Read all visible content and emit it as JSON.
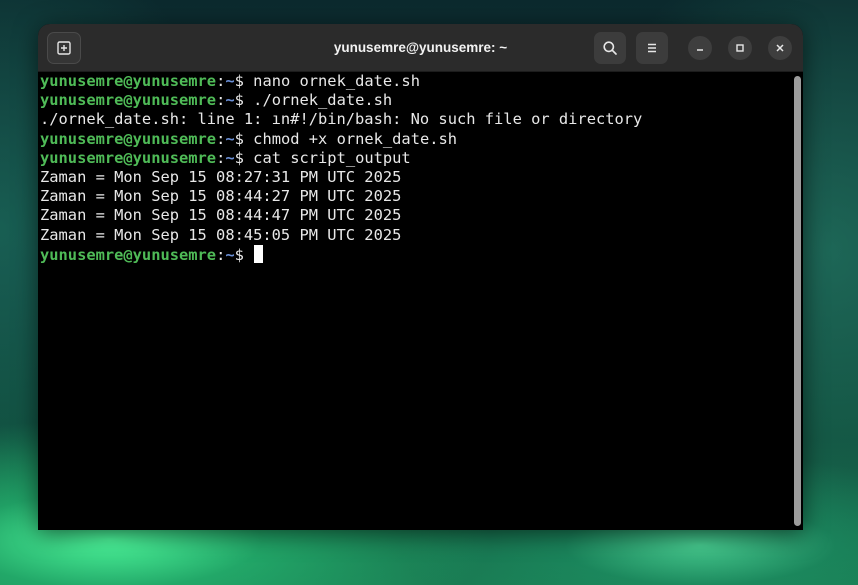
{
  "window": {
    "title": "yunusemre@yunusemre: ~"
  },
  "icons": {
    "new_tab": "new-tab-icon",
    "search": "search-icon",
    "menu": "hamburger-menu-icon",
    "minimize": "minimize-icon",
    "maximize": "maximize-icon",
    "close": "close-icon"
  },
  "colors": {
    "prompt_user": "#4fbb57",
    "prompt_path": "#6a8fd6",
    "terminal_bg": "#000000",
    "text": "#e8e8e8"
  },
  "prompt": {
    "user_host": "yunusemre@yunusemre",
    "colon": ":",
    "path": "~",
    "symbol": "$ "
  },
  "terminal": {
    "lines": [
      {
        "type": "prompt",
        "command": "nano ornek_date.sh"
      },
      {
        "type": "prompt",
        "command": "./ornek_date.sh"
      },
      {
        "type": "output",
        "text": "./ornek_date.sh: line 1: ın#!/bin/bash: No such file or directory"
      },
      {
        "type": "prompt",
        "command": "chmod +x ornek_date.sh"
      },
      {
        "type": "prompt",
        "command": "cat script_output"
      },
      {
        "type": "output",
        "text": "Zaman = Mon Sep 15 08:27:31 PM UTC 2025"
      },
      {
        "type": "output",
        "text": "Zaman = Mon Sep 15 08:44:27 PM UTC 2025"
      },
      {
        "type": "output",
        "text": "Zaman = Mon Sep 15 08:44:47 PM UTC 2025"
      },
      {
        "type": "output",
        "text": "Zaman = Mon Sep 15 08:45:05 PM UTC 2025"
      },
      {
        "type": "prompt",
        "command": "",
        "cursor": true
      }
    ]
  }
}
